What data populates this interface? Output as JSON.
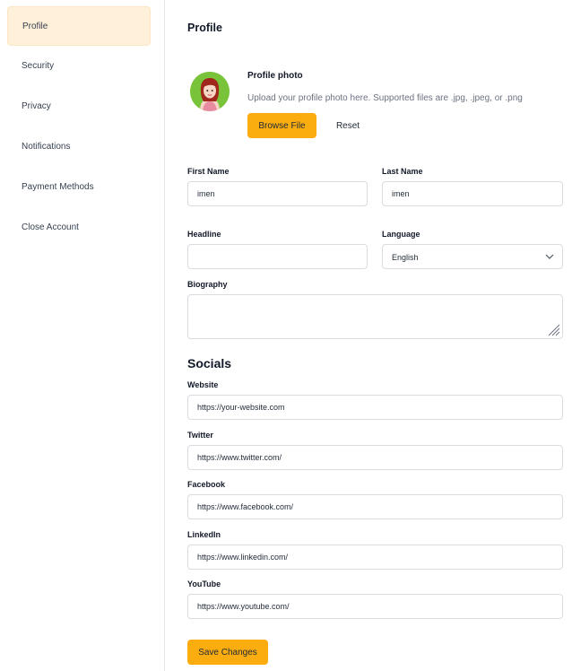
{
  "sidebar": {
    "items": [
      {
        "label": "Profile"
      },
      {
        "label": "Security"
      },
      {
        "label": "Privacy"
      },
      {
        "label": "Notifications"
      },
      {
        "label": "Payment Methods"
      },
      {
        "label": "Close Account"
      }
    ]
  },
  "main": {
    "title": "Profile",
    "photo": {
      "title": "Profile photo",
      "help": "Upload your profile photo here. Supported files are .jpg, .jpeg, or .png",
      "browse_label": "Browse File",
      "reset_label": "Reset"
    },
    "form": {
      "first_name": {
        "label": "First Name",
        "value": "imen"
      },
      "last_name": {
        "label": "Last Name",
        "value": "imen"
      },
      "headline": {
        "label": "Headline",
        "value": ""
      },
      "language": {
        "label": "Language",
        "value": "English"
      },
      "biography": {
        "label": "Biography",
        "value": ""
      }
    },
    "socials": {
      "title": "Socials",
      "website": {
        "label": "Website",
        "value": "https://your-website.com"
      },
      "twitter": {
        "label": "Twitter",
        "value": "https://www.twitter.com/"
      },
      "facebook": {
        "label": "Facebook",
        "value": "https://www.facebook.com/"
      },
      "linkedin": {
        "label": "LinkedIn",
        "value": "https://www.linkedin.com/"
      },
      "youtube": {
        "label": "YouTube",
        "value": "https://www.youtube.com/"
      }
    },
    "save_label": "Save Changes"
  },
  "colors": {
    "accent": "#fbad10",
    "active_bg": "#fef0d9",
    "border": "#d9dce1"
  }
}
